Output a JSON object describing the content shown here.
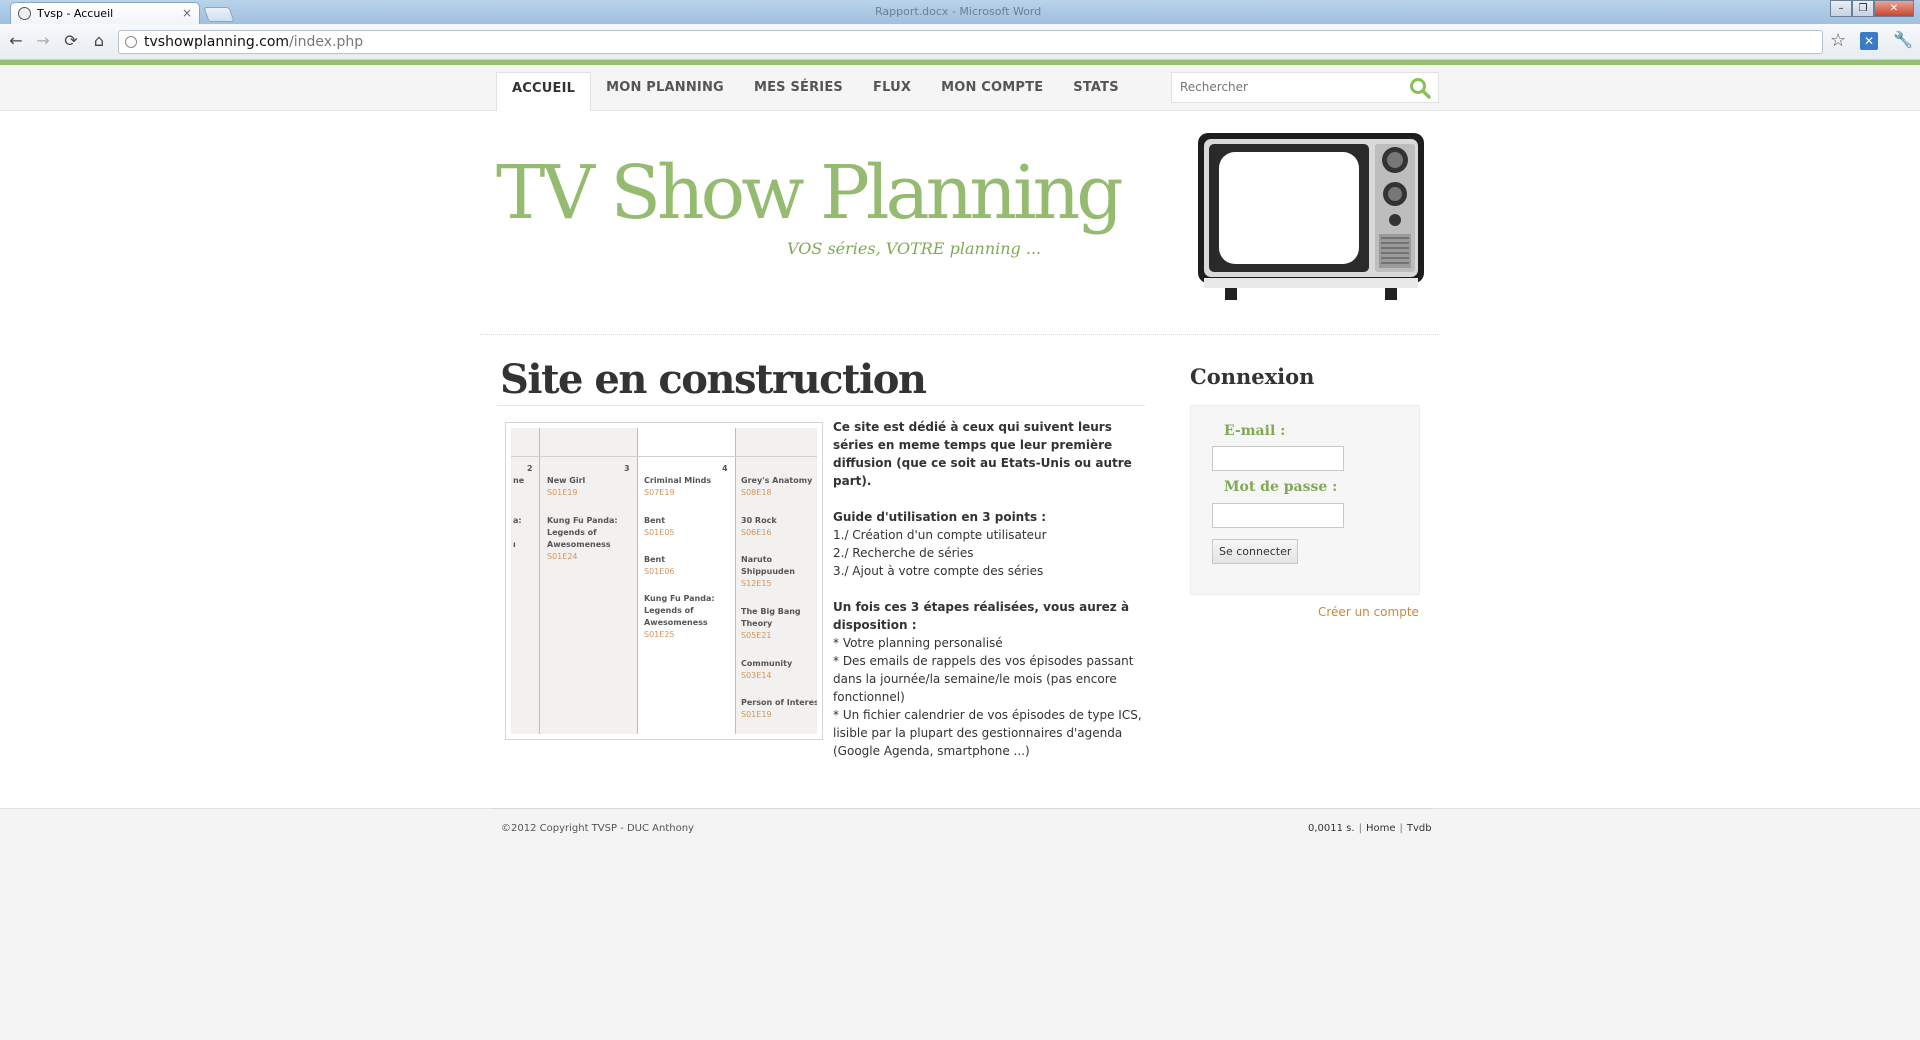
{
  "browser": {
    "tab_title": "Tvsp - Accueil",
    "tab_close": "×",
    "window_title": "Rapport.docx - Microsoft Word",
    "url_host": "tvshowplanning.com",
    "url_path": "/index.php",
    "back_icon": "←",
    "forward_icon": "→",
    "reload_icon": "⟳",
    "home_icon": "⌂",
    "star_icon": "☆",
    "ext_icon": "✕",
    "wrench_icon": "🔧",
    "minimize": "–",
    "maximize": "❐",
    "close": "✕"
  },
  "nav": {
    "items": [
      "ACCUEIL",
      "MON PLANNING",
      "MES SÉRIES",
      "FLUX",
      "MON COMPTE",
      "STATS"
    ],
    "active_index": 0,
    "search_placeholder": "Rechercher"
  },
  "header": {
    "logo": "TV Show Planning",
    "tagline": "VOS séries, VOTRE planning ..."
  },
  "main": {
    "title": "Site en construction",
    "preview": {
      "days": [
        "2",
        "3",
        "4"
      ],
      "col0_entries": [
        {
          "name": "ne",
          "ep": ""
        },
        {
          "name": "a:",
          "ep": ""
        },
        {
          "name": "ı",
          "ep": ""
        }
      ],
      "col1_entries": [
        {
          "name": "New Girl",
          "ep": "S01E19"
        },
        {
          "name": "Kung Fu Panda: Legends of Awesomeness",
          "ep": "S01E24"
        }
      ],
      "col2_entries": [
        {
          "name": "Criminal Minds",
          "ep": "S07E19"
        },
        {
          "name": "Bent",
          "ep": "S01E05"
        },
        {
          "name": "Bent",
          "ep": "S01E06"
        },
        {
          "name": "Kung Fu Panda: Legends of Awesomeness",
          "ep": "S01E25"
        }
      ],
      "col3_entries": [
        {
          "name": "Grey's Anatomy",
          "ep": "S08E18"
        },
        {
          "name": "30 Rock",
          "ep": "S06E16"
        },
        {
          "name": "Naruto Shippuuden",
          "ep": "S12E15"
        },
        {
          "name": "The Big Bang Theory",
          "ep": "S05E21"
        },
        {
          "name": "Community",
          "ep": "S03E14"
        },
        {
          "name": "Person of Interest",
          "ep": "S01E19"
        }
      ]
    },
    "intro": {
      "lead": "Ce site est dédié à ceux qui suivent leurs séries en meme temps que leur première diffusion (que ce soit au Etats-Unis ou autre part).",
      "guide_title": "Guide d'utilisation en 3 points :",
      "steps": [
        "1./ Création d'un compte utilisateur",
        "2./ Recherche de séries",
        "3./ Ajout à votre compte des séries"
      ],
      "dispo_title": "Un fois ces 3 étapes réalisées, vous aurez à disposition :",
      "features": [
        "* Votre planning personalisé",
        "* Des emails de rappels des vos épisodes passant dans la journée/la semaine/le mois (pas encore fonctionnel)",
        "* Un fichier calendrier de vos épisodes de type ICS, lisible par la plupart des gestionnaires d'agenda (Google Agenda, smartphone ...)"
      ]
    }
  },
  "sidebar": {
    "title": "Connexion",
    "email_label": "E-mail :",
    "password_label": "Mot de passe :",
    "submit_label": "Se connecter",
    "create_account": "Créer un compte"
  },
  "footer": {
    "copyright": "©2012 Copyright TVSP - DUC Anthony",
    "timing": "0,0011 s.",
    "link_home": "Home",
    "link_tvdb": "Tvdb",
    "separator": "|"
  },
  "colors": {
    "accent_green": "#95bb70",
    "link_orange": "#c9893d",
    "episode_orange": "#d4955a"
  }
}
